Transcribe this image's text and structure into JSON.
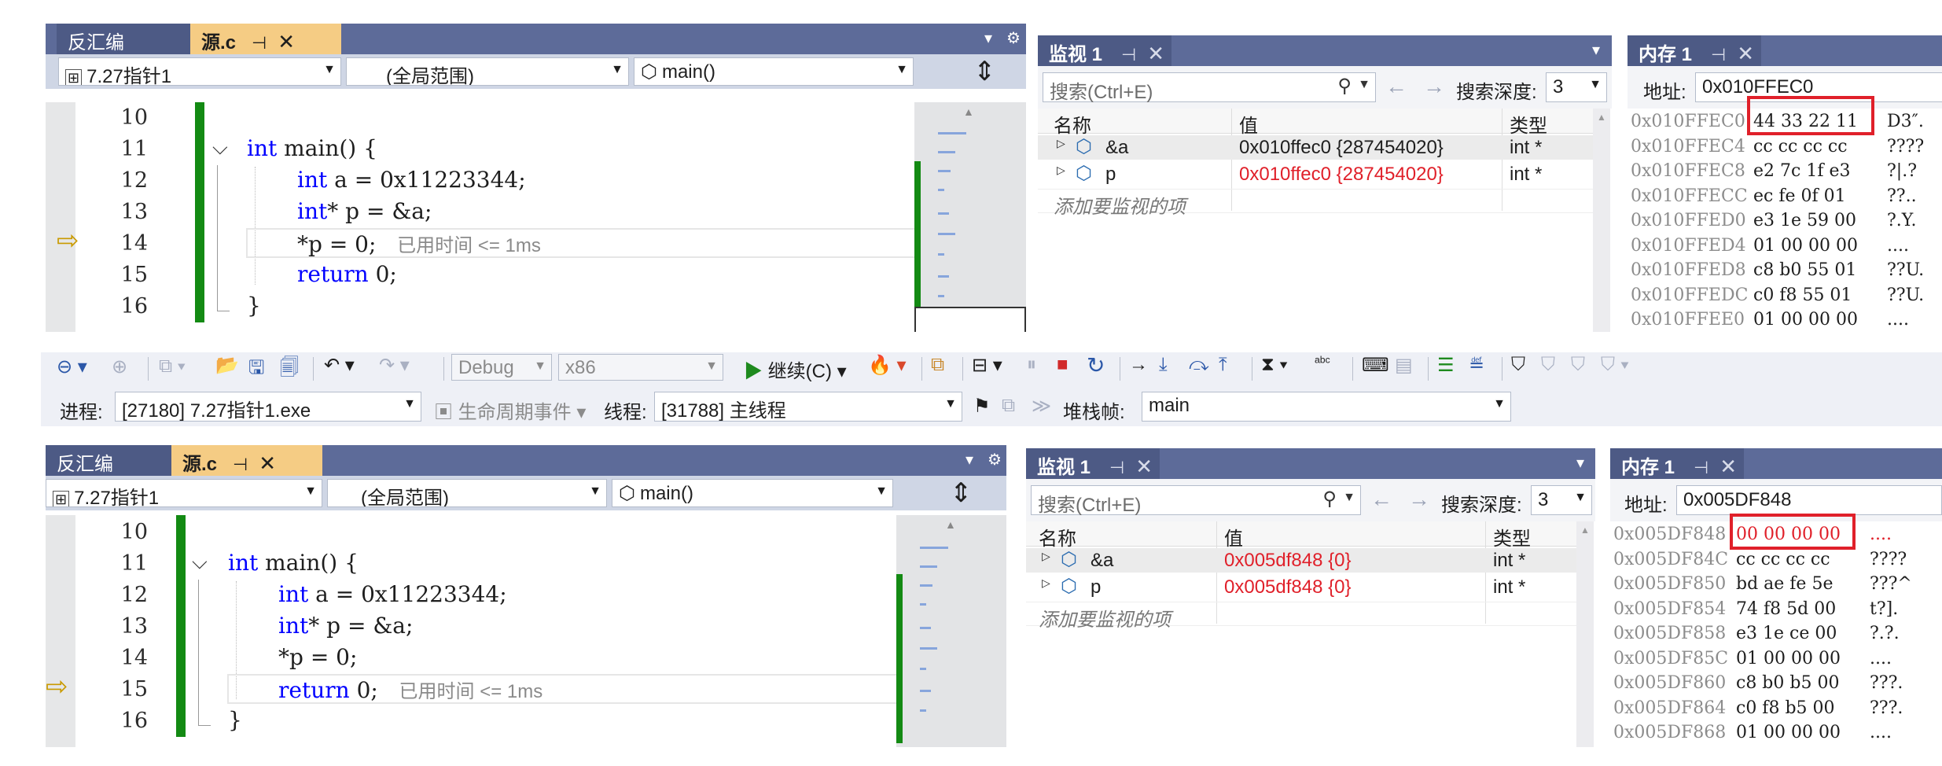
{
  "top": {
    "tabs": {
      "disasm": "反汇编",
      "source": "源.c",
      "pin": "⊣",
      "close": "✕"
    },
    "nav": {
      "project": "7.27指针1",
      "scope": "(全局范围)",
      "func": "main()",
      "split": "⇕"
    },
    "lines": [
      "10",
      "11",
      "12",
      "13",
      "14",
      "15",
      "16"
    ],
    "code": {
      "l11_kw": "int",
      "l11_rest": " main() {",
      "l12_kw": "int",
      "l12_rest": " a = 0x11223344;",
      "l13_kw": "int",
      "l13_rest": "* p = &a;",
      "l14": "*p = 0;",
      "l15_kw": "return",
      "l15_rest": " 0;",
      "l16": "}",
      "elapsed": "已用时间 <= 1ms"
    },
    "watch": {
      "title": "监视 1",
      "search_placeholder": "搜索(Ctrl+E)",
      "depth_label": "搜索深度:",
      "depth_value": "3",
      "headers": {
        "name": "名称",
        "value": "值",
        "type": "类型"
      },
      "rows": [
        {
          "name": "&a",
          "value": "0x010ffec0 {287454020}",
          "type": "int *"
        },
        {
          "name": "p",
          "value": "0x010ffec0 {287454020}",
          "type": "int *"
        }
      ],
      "add_item": "添加要监视的项"
    },
    "memory": {
      "title": "内存 1",
      "addr_label": "地址:",
      "addr_value": "0x010FFEC0",
      "rows": [
        {
          "addr": "0x010FFEC0",
          "bytes": "44 33 22 11",
          "chars": "D3″."
        },
        {
          "addr": "0x010FFEC4",
          "bytes": "cc cc cc cc",
          "chars": "????"
        },
        {
          "addr": "0x010FFEC8",
          "bytes": "e2 7c 1f e3",
          "chars": "?|.?"
        },
        {
          "addr": "0x010FFECC",
          "bytes": "ec fe 0f 01",
          "chars": "??.."
        },
        {
          "addr": "0x010FFED0",
          "bytes": "e3 1e 59 00",
          "chars": "?.Y."
        },
        {
          "addr": "0x010FFED4",
          "bytes": "01 00 00 00",
          "chars": "...."
        },
        {
          "addr": "0x010FFED8",
          "bytes": "c8 b0 55 01",
          "chars": "??U."
        },
        {
          "addr": "0x010FFEDC",
          "bytes": "c0 f8 55 01",
          "chars": "??U."
        },
        {
          "addr": "0x010FFEE0",
          "bytes": "01 00 00 00",
          "chars": "...."
        }
      ]
    }
  },
  "toolbar": {
    "config": "Debug",
    "platform": "x86",
    "continue": "继续(C)",
    "process_label": "进程:",
    "process_value": "[27180] 7.27指针1.exe",
    "lifecycle": "生命周期事件",
    "thread_label": "线程:",
    "thread_value": "[31788] 主线程",
    "stack_label": "堆栈帧:",
    "stack_value": "main"
  },
  "bottom": {
    "tabs": {
      "disasm": "反汇编",
      "source": "源.c",
      "pin": "⊣",
      "close": "✕"
    },
    "nav": {
      "project": "7.27指针1",
      "scope": "(全局范围)",
      "func": "main()",
      "split": "⇕"
    },
    "lines": [
      "10",
      "11",
      "12",
      "13",
      "14",
      "15",
      "16"
    ],
    "code": {
      "l11_kw": "int",
      "l11_rest": " main() {",
      "l12_kw": "int",
      "l12_rest": " a = 0x11223344;",
      "l13_kw": "int",
      "l13_rest": "* p = &a;",
      "l14": "*p = 0;",
      "l15_kw": "return",
      "l15_rest": " 0;",
      "l16": "}",
      "elapsed": "已用时间 <= 1ms"
    },
    "watch": {
      "title": "监视 1",
      "search_placeholder": "搜索(Ctrl+E)",
      "depth_label": "搜索深度:",
      "depth_value": "3",
      "headers": {
        "name": "名称",
        "value": "值",
        "type": "类型"
      },
      "rows": [
        {
          "name": "&a",
          "value": "0x005df848 {0}",
          "type": "int *"
        },
        {
          "name": "p",
          "value": "0x005df848 {0}",
          "type": "int *"
        }
      ],
      "add_item": "添加要监视的项"
    },
    "memory": {
      "title": "内存 1",
      "addr_label": "地址:",
      "addr_value": "0x005DF848",
      "rows": [
        {
          "addr": "0x005DF848",
          "bytes": "00 00 00 00",
          "chars": "...."
        },
        {
          "addr": "0x005DF84C",
          "bytes": "cc cc cc cc",
          "chars": "????"
        },
        {
          "addr": "0x005DF850",
          "bytes": "bd ae fe 5e",
          "chars": "???^"
        },
        {
          "addr": "0x005DF854",
          "bytes": "74 f8 5d 00",
          "chars": "t?]."
        },
        {
          "addr": "0x005DF858",
          "bytes": "e3 1e ce 00",
          "chars": "?.?."
        },
        {
          "addr": "0x005DF85C",
          "bytes": "01 00 00 00",
          "chars": "...."
        },
        {
          "addr": "0x005DF860",
          "bytes": "c8 b0 b5 00",
          "chars": "???."
        },
        {
          "addr": "0x005DF864",
          "bytes": "c0 f8 b5 00",
          "chars": "???."
        },
        {
          "addr": "0x005DF868",
          "bytes": "01 00 00 00",
          "chars": "...."
        }
      ]
    }
  },
  "colors": {
    "accent": "#5d6b99",
    "tab_active": "#f5cc84",
    "changed": "#e0202a",
    "keyword": "#0000ff",
    "modified_bar": "#138a13"
  },
  "icons": [
    "pin-icon",
    "close-icon",
    "dropdown-icon",
    "settings-icon",
    "split-icon",
    "execution-arrow-icon",
    "search-icon",
    "back-icon",
    "forward-icon",
    "variable-icon",
    "expand-icon",
    "continue-icon",
    "stop-icon",
    "restart-icon",
    "step-into-icon",
    "step-over-icon",
    "step-out-icon",
    "undo-icon",
    "redo-icon",
    "save-icon",
    "open-folder-icon",
    "flag-icon",
    "lifecycle-icon",
    "hot-reload-icon",
    "bookmark-icon"
  ]
}
